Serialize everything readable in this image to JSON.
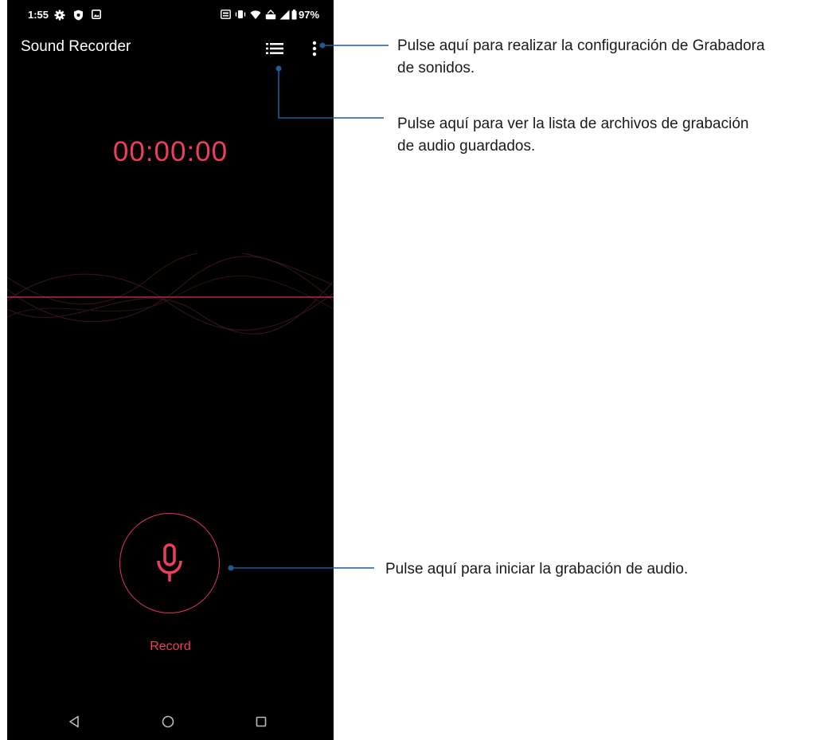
{
  "status_bar": {
    "time": "1:55",
    "battery": "97%",
    "left_icons": [
      "gear-icon",
      "shield-icon",
      "image-icon"
    ],
    "right_icons": [
      "sim-icon",
      "vibrate-icon",
      "wifi-icon",
      "volte-icon",
      "signal-icon",
      "battery-icon"
    ]
  },
  "app": {
    "title": "Sound Recorder",
    "timer": "00:00:00",
    "record_label": "Record",
    "accent_color": "#ee3e5c"
  },
  "toolbar": {
    "list_icon": "list-icon",
    "menu_icon": "more-vertical-icon"
  },
  "nav": {
    "back": "back-icon",
    "home": "home-icon",
    "recents": "recents-icon"
  },
  "annotations": {
    "settings_l1": "Pulse aquí para realizar la configuración de Grabadora",
    "settings_l2": "de sonidos.",
    "list_l1": "Pulse aquí para ver la lista de archivos de grabación",
    "list_l2": "de audio guardados.",
    "record": "Pulse aquí para iniciar la grabación de audio.",
    "line_color": "#1f5b96"
  }
}
